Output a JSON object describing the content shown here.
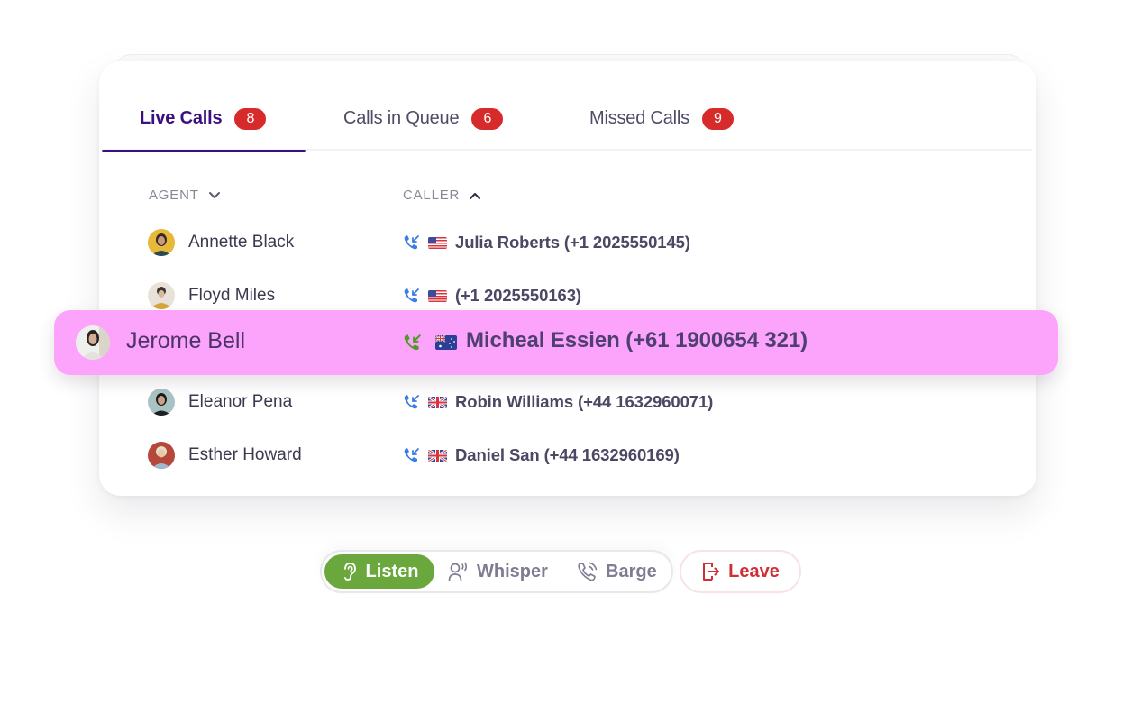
{
  "tabs": [
    {
      "label": "Live Calls",
      "count": "8",
      "active": true
    },
    {
      "label": "Calls in Queue",
      "count": "6",
      "active": false
    },
    {
      "label": "Missed Calls",
      "count": "9",
      "active": false
    }
  ],
  "columns": {
    "agent": {
      "label": "AGENT",
      "sort": "descending",
      "sort_icon": "chevron-down-icon"
    },
    "caller": {
      "label": "CALLER",
      "sort": "ascending",
      "sort_icon": "chevron-up-icon"
    }
  },
  "rows": [
    {
      "agent": "Annette Black",
      "caller": "Julia Roberts (+1 2025550145)",
      "country": "US",
      "call_icon": "incoming-call-icon"
    },
    {
      "agent": "Floyd Miles",
      "caller": "(+1 2025550163)",
      "country": "US",
      "call_icon": "incoming-call-icon"
    },
    {
      "agent": "Jerome Bell",
      "caller": "Micheal Essien (+61 1900654 321)",
      "country": "AU",
      "call_icon": "incoming-call-icon",
      "selected": true
    },
    {
      "agent": "Eleanor Pena",
      "caller": "Robin Williams (+44 1632960071)",
      "country": "GB",
      "call_icon": "incoming-call-icon"
    },
    {
      "agent": "Esther Howard",
      "caller": "Daniel San (+44 1632960169)",
      "country": "GB",
      "call_icon": "incoming-call-icon"
    }
  ],
  "controls": {
    "listen": {
      "label": "Listen",
      "icon": "ear-icon",
      "active": true
    },
    "whisper": {
      "label": "Whisper",
      "icon": "person-speaking-icon",
      "active": false
    },
    "barge": {
      "label": "Barge",
      "icon": "phone-ringing-icon",
      "active": false
    },
    "leave": {
      "label": "Leave",
      "icon": "exit-icon"
    }
  },
  "colors": {
    "accent": "#3b0f7e",
    "badge": "#d72b2b",
    "highlight": "#fca4fb",
    "listen_active": "#6aa83e",
    "leave": "#cf2f35",
    "incoming_call": "#3b7be6",
    "selected_call": "#4e9a23"
  }
}
